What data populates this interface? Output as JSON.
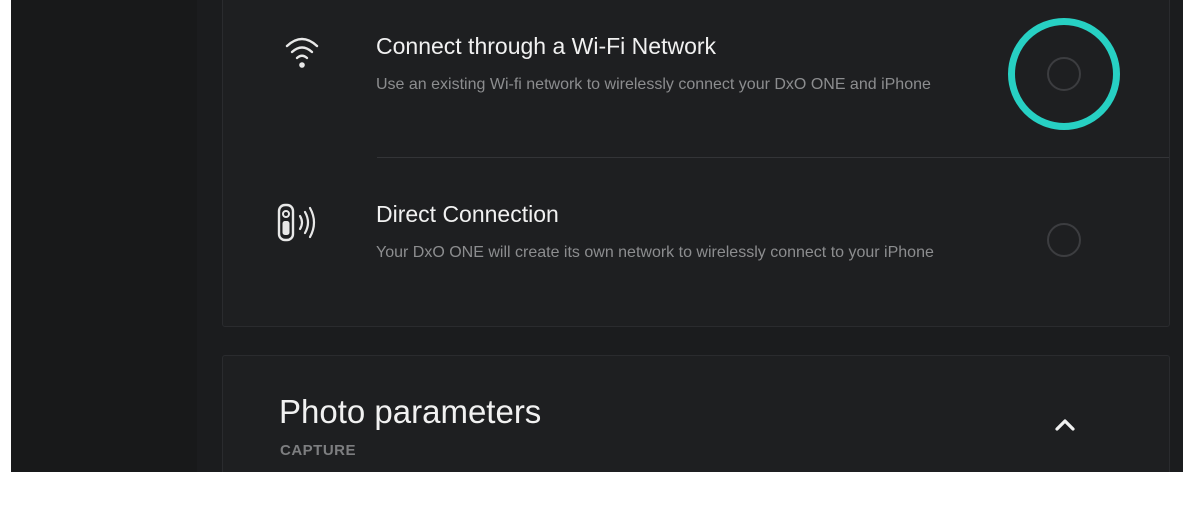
{
  "connection_options": [
    {
      "icon": "wifi-icon",
      "title": "Connect through a Wi-Fi Network",
      "description": "Use an existing Wi-fi network to wirelessly connect your DxO ONE and iPhone",
      "selected": true
    },
    {
      "icon": "camera-signal-icon",
      "title": "Direct Connection",
      "description": "Your DxO ONE will create its own network to wirelessly connect to your iPhone",
      "selected": false
    }
  ],
  "photo_parameters": {
    "title": "Photo parameters",
    "subtitle": "CAPTURE",
    "toggle_icon": "chevron-up-icon"
  },
  "colors": {
    "accent": "#27d0c3",
    "background": "#1b1c1e",
    "card": "#1e1f21",
    "title_text": "#f1f1f1",
    "description_text": "#8c8d8f"
  }
}
